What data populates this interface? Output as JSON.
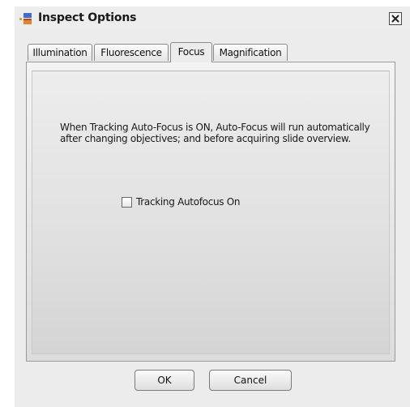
{
  "window": {
    "title": "Inspect Options",
    "icon": "app-window-icon",
    "close_icon": "close-icon"
  },
  "tabs": [
    {
      "label": "Illumination",
      "active": false
    },
    {
      "label": "Fluorescence",
      "active": false
    },
    {
      "label": "Focus",
      "active": true
    },
    {
      "label": "Magnification",
      "active": false
    }
  ],
  "focus_panel": {
    "description": "When Tracking Auto-Focus is ON, Auto-Focus will run automatically after changing objectives; and before acquiring slide overview.",
    "checkbox": {
      "label": "Tracking Autofocus On",
      "checked": false
    }
  },
  "buttons": {
    "ok_label": "OK",
    "cancel_label": "Cancel"
  }
}
